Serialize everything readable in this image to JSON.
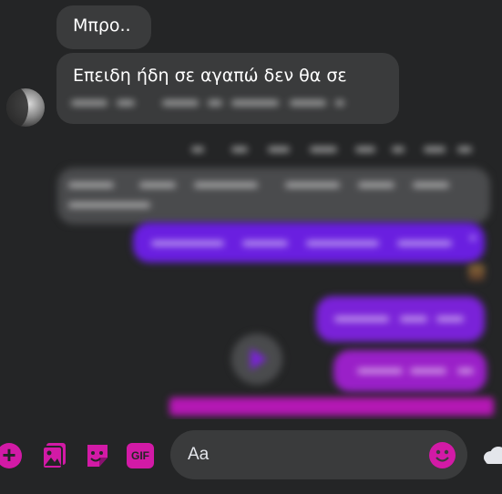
{
  "conversation": {
    "messages": [
      {
        "id": "m1",
        "direction": "incoming",
        "text": "Μπρο.."
      },
      {
        "id": "m2",
        "direction": "incoming",
        "text": "Επειδη ήδη σε αγαπώ δεν θα σε",
        "continuation_blurred": true
      }
    ],
    "timestamp_blurred": true,
    "blurred_messages": [
      {
        "direction": "incoming",
        "color": "#4a4b4d"
      },
      {
        "direction": "outgoing",
        "color": "#6a1fe0"
      },
      {
        "direction": "outgoing",
        "color": "#7a22d8"
      },
      {
        "direction": "outgoing",
        "color": "#9a20c8"
      },
      {
        "direction": "outgoing",
        "color": "#b418b4"
      }
    ]
  },
  "composer": {
    "placeholder": "Aa",
    "actions": [
      {
        "name": "plus-icon",
        "glyph": "+"
      },
      {
        "name": "image-icon"
      },
      {
        "name": "sticker-icon"
      },
      {
        "name": "gif-icon",
        "label": "GIF"
      }
    ],
    "emoji_icon": "emoji-icon",
    "cloud_icon": "cloud-icon"
  },
  "colors": {
    "background": "#242526",
    "incoming_bubble": "#3a3b3c",
    "accent": "#d21aa6",
    "outgoing_start": "#6b2ff0",
    "outgoing_end": "#c81aa8"
  }
}
